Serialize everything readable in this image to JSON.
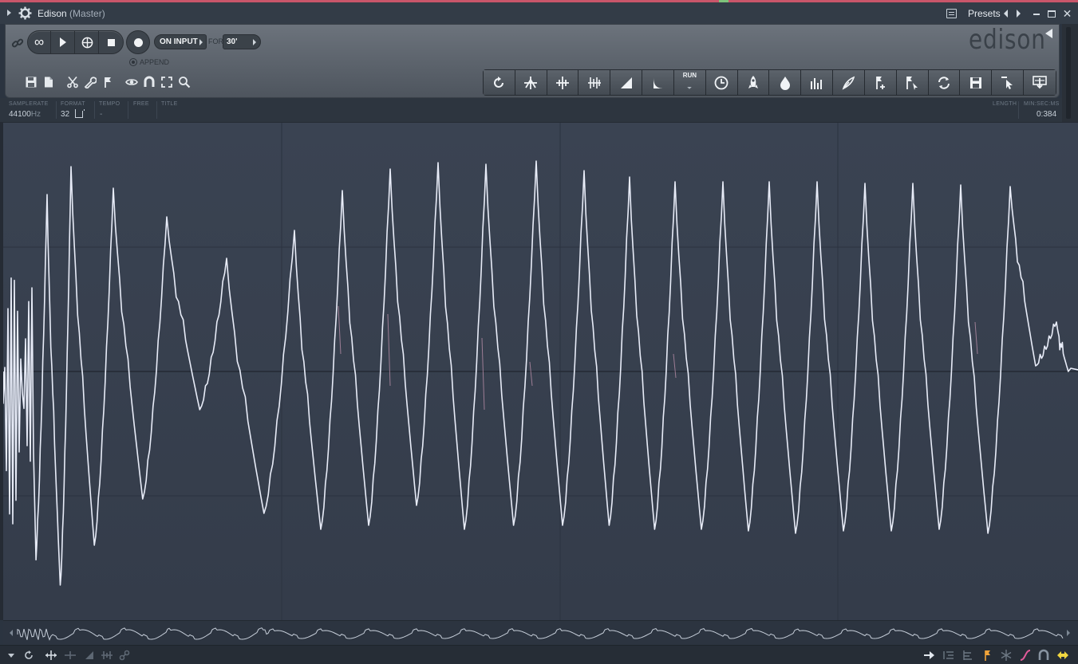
{
  "window": {
    "title": "Edison",
    "subtitle": "(Master)",
    "presets_label": "Presets"
  },
  "recorder": {
    "mode": "ON INPUT",
    "for_label": "FOR",
    "duration": "30'",
    "append_label": "APPEND"
  },
  "logo": "edison",
  "info": {
    "samplerate_label": "SAMPLERATE",
    "samplerate_value": "44100",
    "samplerate_unit": "Hz",
    "format_label": "FORMAT",
    "format_value": "32",
    "tempo_label": "TEMPO",
    "tempo_value": "-",
    "free_label": "FREE",
    "title_label": "TITLE",
    "length_label": "LENGTH",
    "minsecms_label": "MIN:SEC:MS",
    "length_value": "0:384"
  },
  "toolbar": {
    "run_label": "RUN",
    "tools": [
      "reverse-icon",
      "normalize-icon",
      "amplify-icon",
      "declick-icon",
      "fade-in-icon",
      "fade-out-icon",
      "run-tool",
      "time-stretch-icon",
      "rocket-icon",
      "droplet-icon",
      "equalizer-icon",
      "spectral-brush-icon",
      "add-marker-icon",
      "marker-tool-icon",
      "loop-icon",
      "save-region-icon",
      "select-cursor-icon",
      "send-to-playlist-icon"
    ]
  },
  "colors": {
    "accent": "#c9566a",
    "waveform": "#e8ecf8",
    "waveform_bg": "#3a4352",
    "panel": "#5e656e"
  }
}
